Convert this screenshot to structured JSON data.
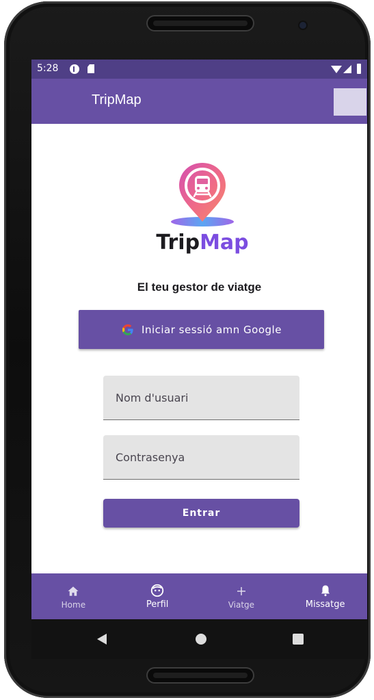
{
  "status_bar": {
    "time": "5:28"
  },
  "app_bar": {
    "title": "TripMap"
  },
  "logo": {
    "word_part1": "Trip",
    "word_part2": "Map",
    "color_dark": "#1c1b1f",
    "color_accent": "#7b4de0"
  },
  "main": {
    "subtitle": "El teu gestor de viatge",
    "google_button_label": "Iniciar sessió amn Google",
    "username_placeholder": "Nom d'usuari",
    "password_placeholder": "Contrasenya",
    "login_button_label": "Entrar"
  },
  "bottom_nav": {
    "items": [
      {
        "label": "Home",
        "icon": "home-icon"
      },
      {
        "label": "Perfil",
        "icon": "face-icon"
      },
      {
        "label": "Viatge",
        "icon": "plus-icon"
      },
      {
        "label": "Missatge",
        "icon": "bell-icon"
      }
    ]
  },
  "colors": {
    "primary": "#6750a4",
    "status_bar": "#4f3f86",
    "field_bg": "#e4e4e4"
  }
}
